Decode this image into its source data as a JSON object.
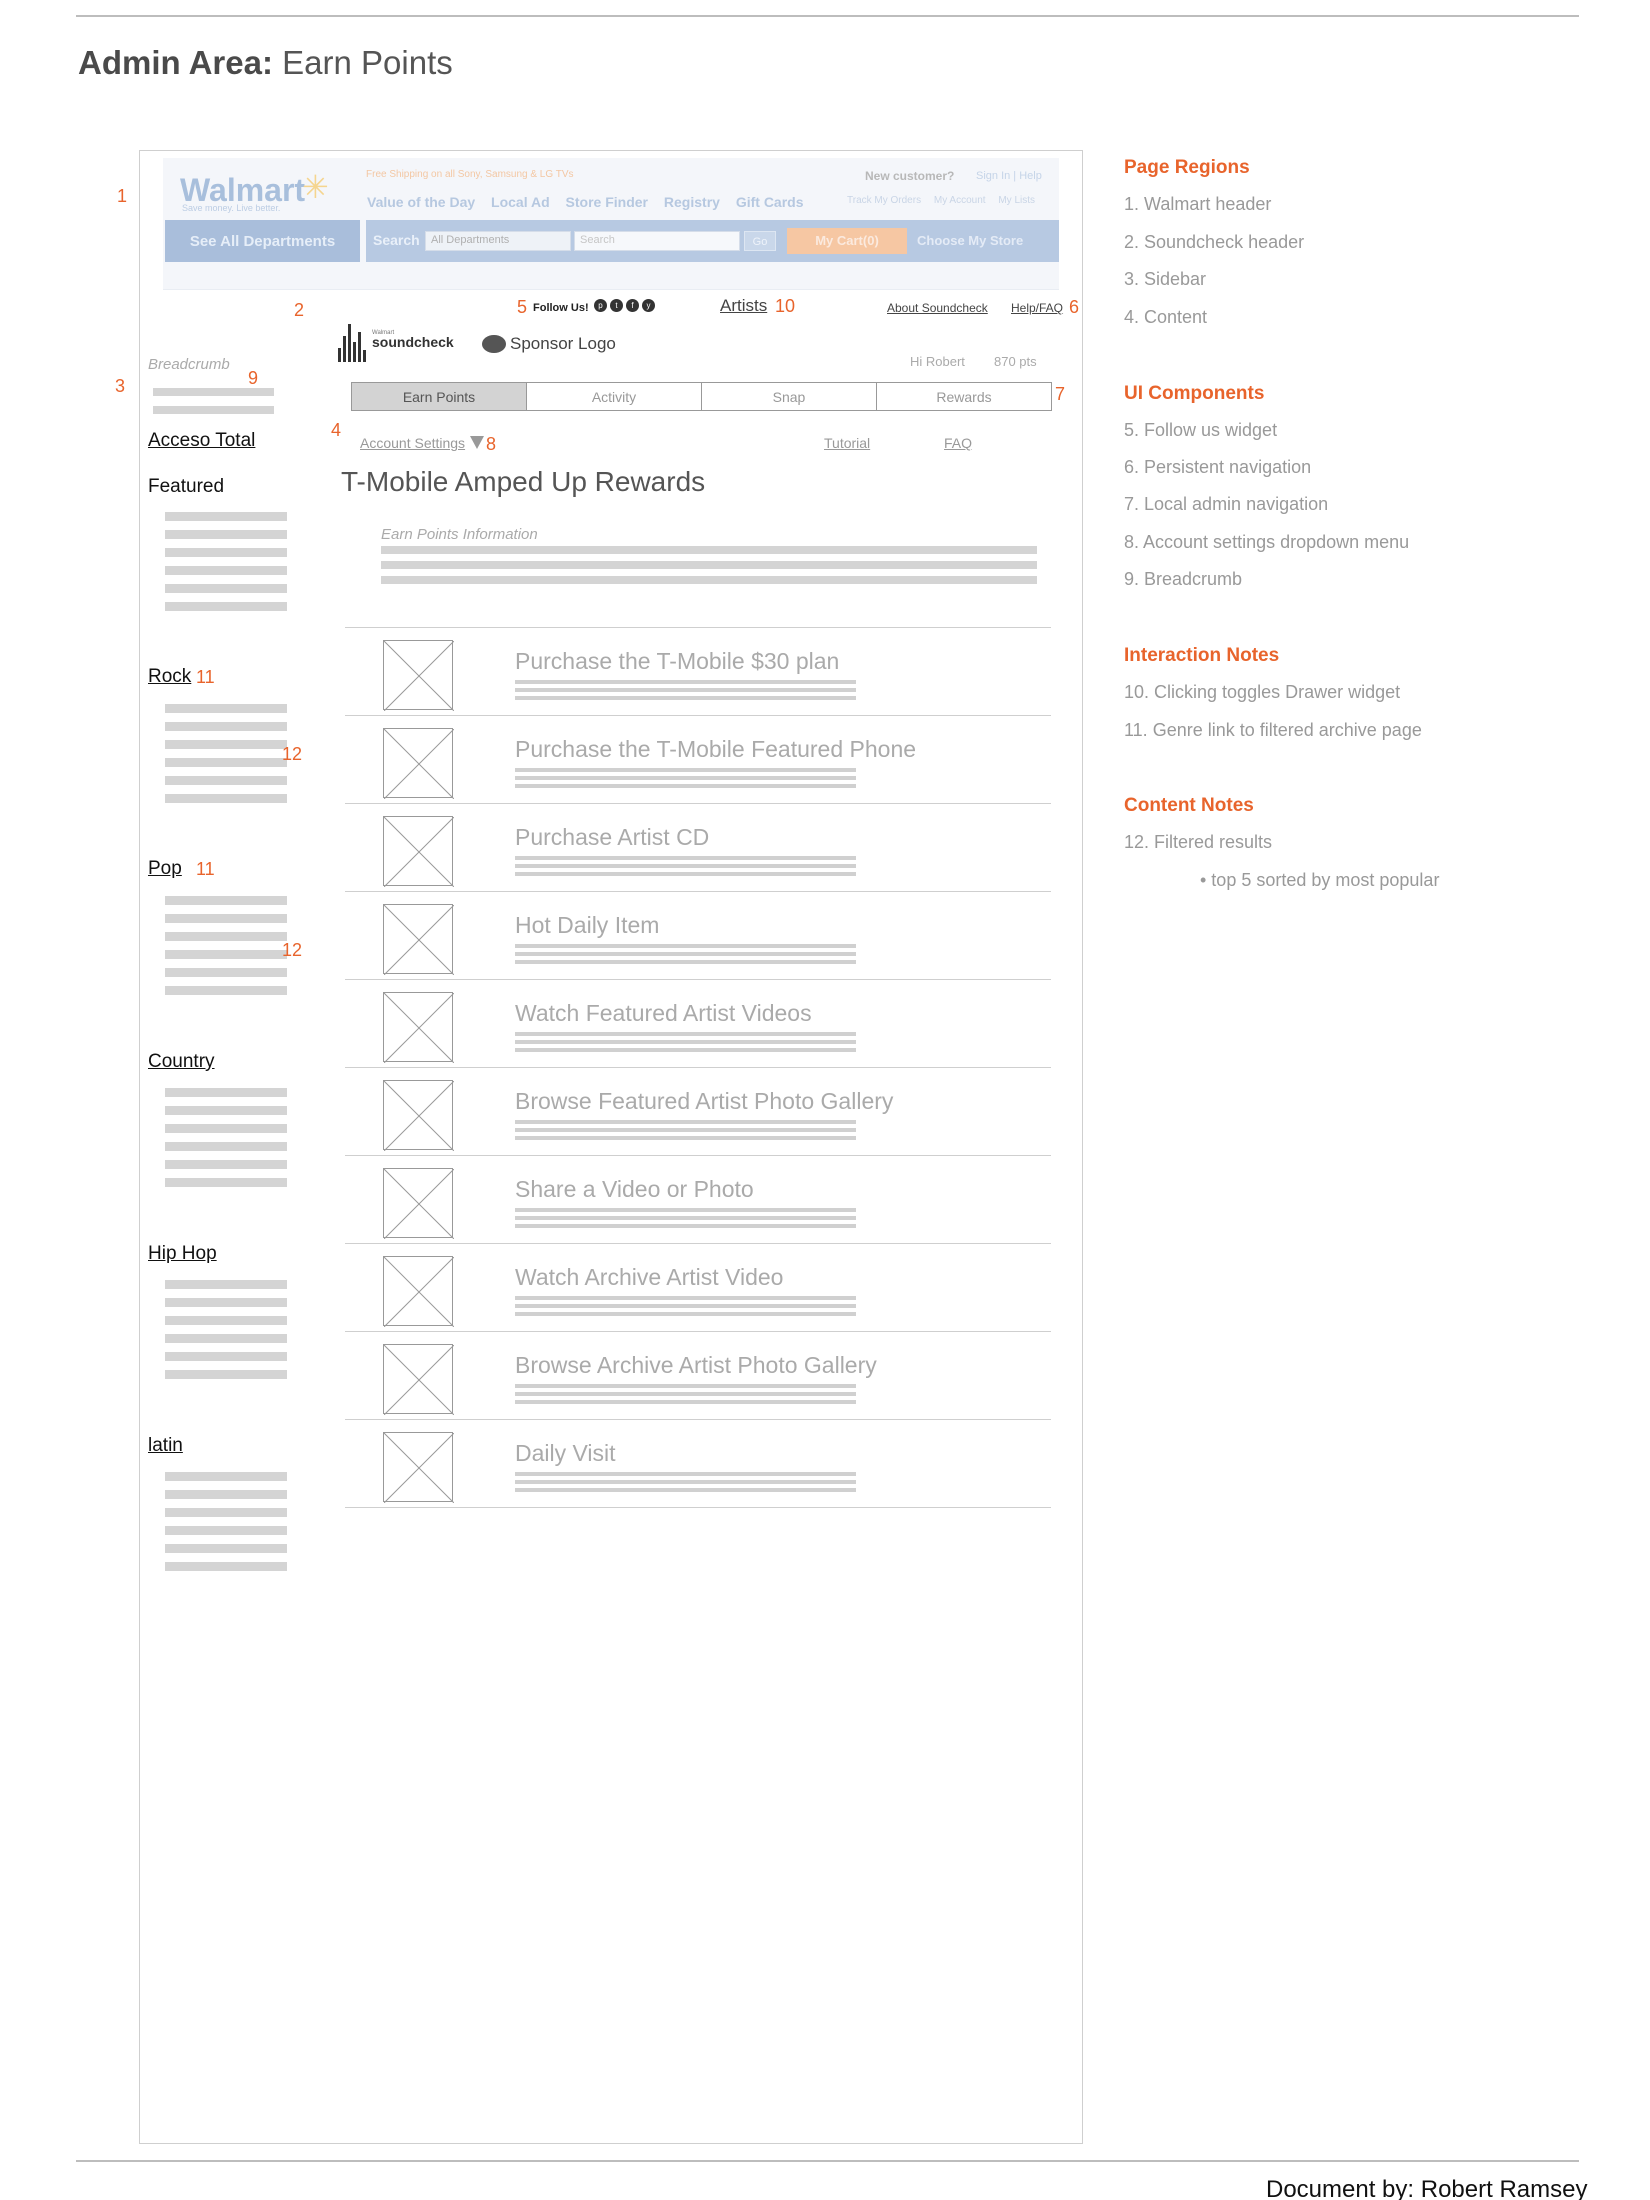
{
  "document": {
    "title_bold": "Admin Area:",
    "title_rest": " Earn Points",
    "footer": "Document by: Robert Ramsey"
  },
  "walmart_header": {
    "logo": "Walmart",
    "tagline": "Save money. Live better.",
    "promo": "Free Shipping on all Sony, Samsung & LG TVs",
    "new_customer": "New customer?",
    "sign_in": "Sign In | Help",
    "nav": [
      "Value of the Day",
      "Local Ad",
      "Store Finder",
      "Registry",
      "Gift Cards"
    ],
    "account_links": [
      "Track My Orders",
      "My Account",
      "My Lists"
    ],
    "departments": "See All Departments",
    "search_label": "Search",
    "dept_select": "All Departments",
    "search_placeholder": "Search",
    "go": "Go",
    "cart": "My Cart(0)",
    "store": "Choose My Store"
  },
  "soundcheck_header": {
    "follow_us": "Follow Us!",
    "social_icons": [
      "pinterest-icon",
      "twitter-icon",
      "facebook-icon",
      "youtube-icon"
    ],
    "artists": "Artists",
    "about": "About Soundcheck",
    "help": "Help/FAQ",
    "logo_small": "Walmart",
    "logo": "soundcheck",
    "sponsor": "Sponsor Logo",
    "greeting": "Hi Robert",
    "points": "870 pts"
  },
  "sidebar": {
    "breadcrumb": "Breadcrumb",
    "acceso_total": "Acceso Total",
    "featured": "Featured",
    "genres": [
      "Rock",
      "Pop",
      "Country",
      "Hip Hop",
      "latin"
    ]
  },
  "tabs": [
    "Earn Points",
    "Activity",
    "Snap",
    "Rewards"
  ],
  "content": {
    "account_settings": "Account Settings",
    "tutorial": "Tutorial",
    "faq": "FAQ",
    "heading": "T-Mobile Amped Up Rewards",
    "info_label": "Earn Points Information",
    "items": [
      "Purchase the T-Mobile $30 plan",
      "Purchase the T-Mobile Featured Phone",
      "Purchase Artist CD",
      "Hot Daily Item",
      "Watch Featured Artist Videos",
      "Browse Featured Artist Photo Gallery",
      "Share a Video or Photo",
      "Watch Archive Artist Video",
      "Browse Archive Artist Photo Gallery",
      "Daily Visit"
    ]
  },
  "callouts": {
    "n1": "1",
    "n2": "2",
    "n3": "3",
    "n4": "4",
    "n5": "5",
    "n6": "6",
    "n7": "7",
    "n8": "8",
    "n9": "9",
    "n10": "10",
    "n11": "11",
    "n12": "12"
  },
  "notes": {
    "page_regions": {
      "heading": "Page Regions",
      "items": [
        "1. Walmart header",
        "2. Soundcheck header",
        "3. Sidebar",
        "4. Content"
      ]
    },
    "ui_components": {
      "heading": "UI Components",
      "items": [
        "5. Follow us widget",
        "6. Persistent navigation",
        "7. Local admin navigation",
        "8. Account settings dropdown menu",
        "9. Breadcrumb"
      ]
    },
    "interaction_notes": {
      "heading": "Interaction Notes",
      "items": [
        "10. Clicking toggles Drawer widget",
        "11. Genre link to filtered archive page"
      ]
    },
    "content_notes": {
      "heading": "Content Notes",
      "items": [
        "12. Filtered results",
        "• top 5 sorted by most popular"
      ]
    }
  }
}
